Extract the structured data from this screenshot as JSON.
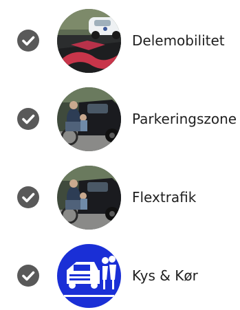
{
  "items": [
    {
      "label": "Delemobilitet",
      "checked": true,
      "check_icon": "check-circle-icon",
      "image": "shared-mobility-parking-photo"
    },
    {
      "label": "Parkeringszone",
      "checked": true,
      "check_icon": "check-circle-icon",
      "image": "wheelchair-car-photo"
    },
    {
      "label": "Flextrafik",
      "checked": true,
      "check_icon": "check-circle-icon",
      "image": "wheelchair-car-photo"
    },
    {
      "label": "Kys & Kør",
      "checked": true,
      "check_icon": "check-circle-icon",
      "image": "kiss-and-ride-sign-icon"
    }
  ],
  "colors": {
    "check_bg": "#595959",
    "check_mark": "#ffffff",
    "text": "#1f1f1f",
    "sign_blue": "#1a2fd6"
  }
}
